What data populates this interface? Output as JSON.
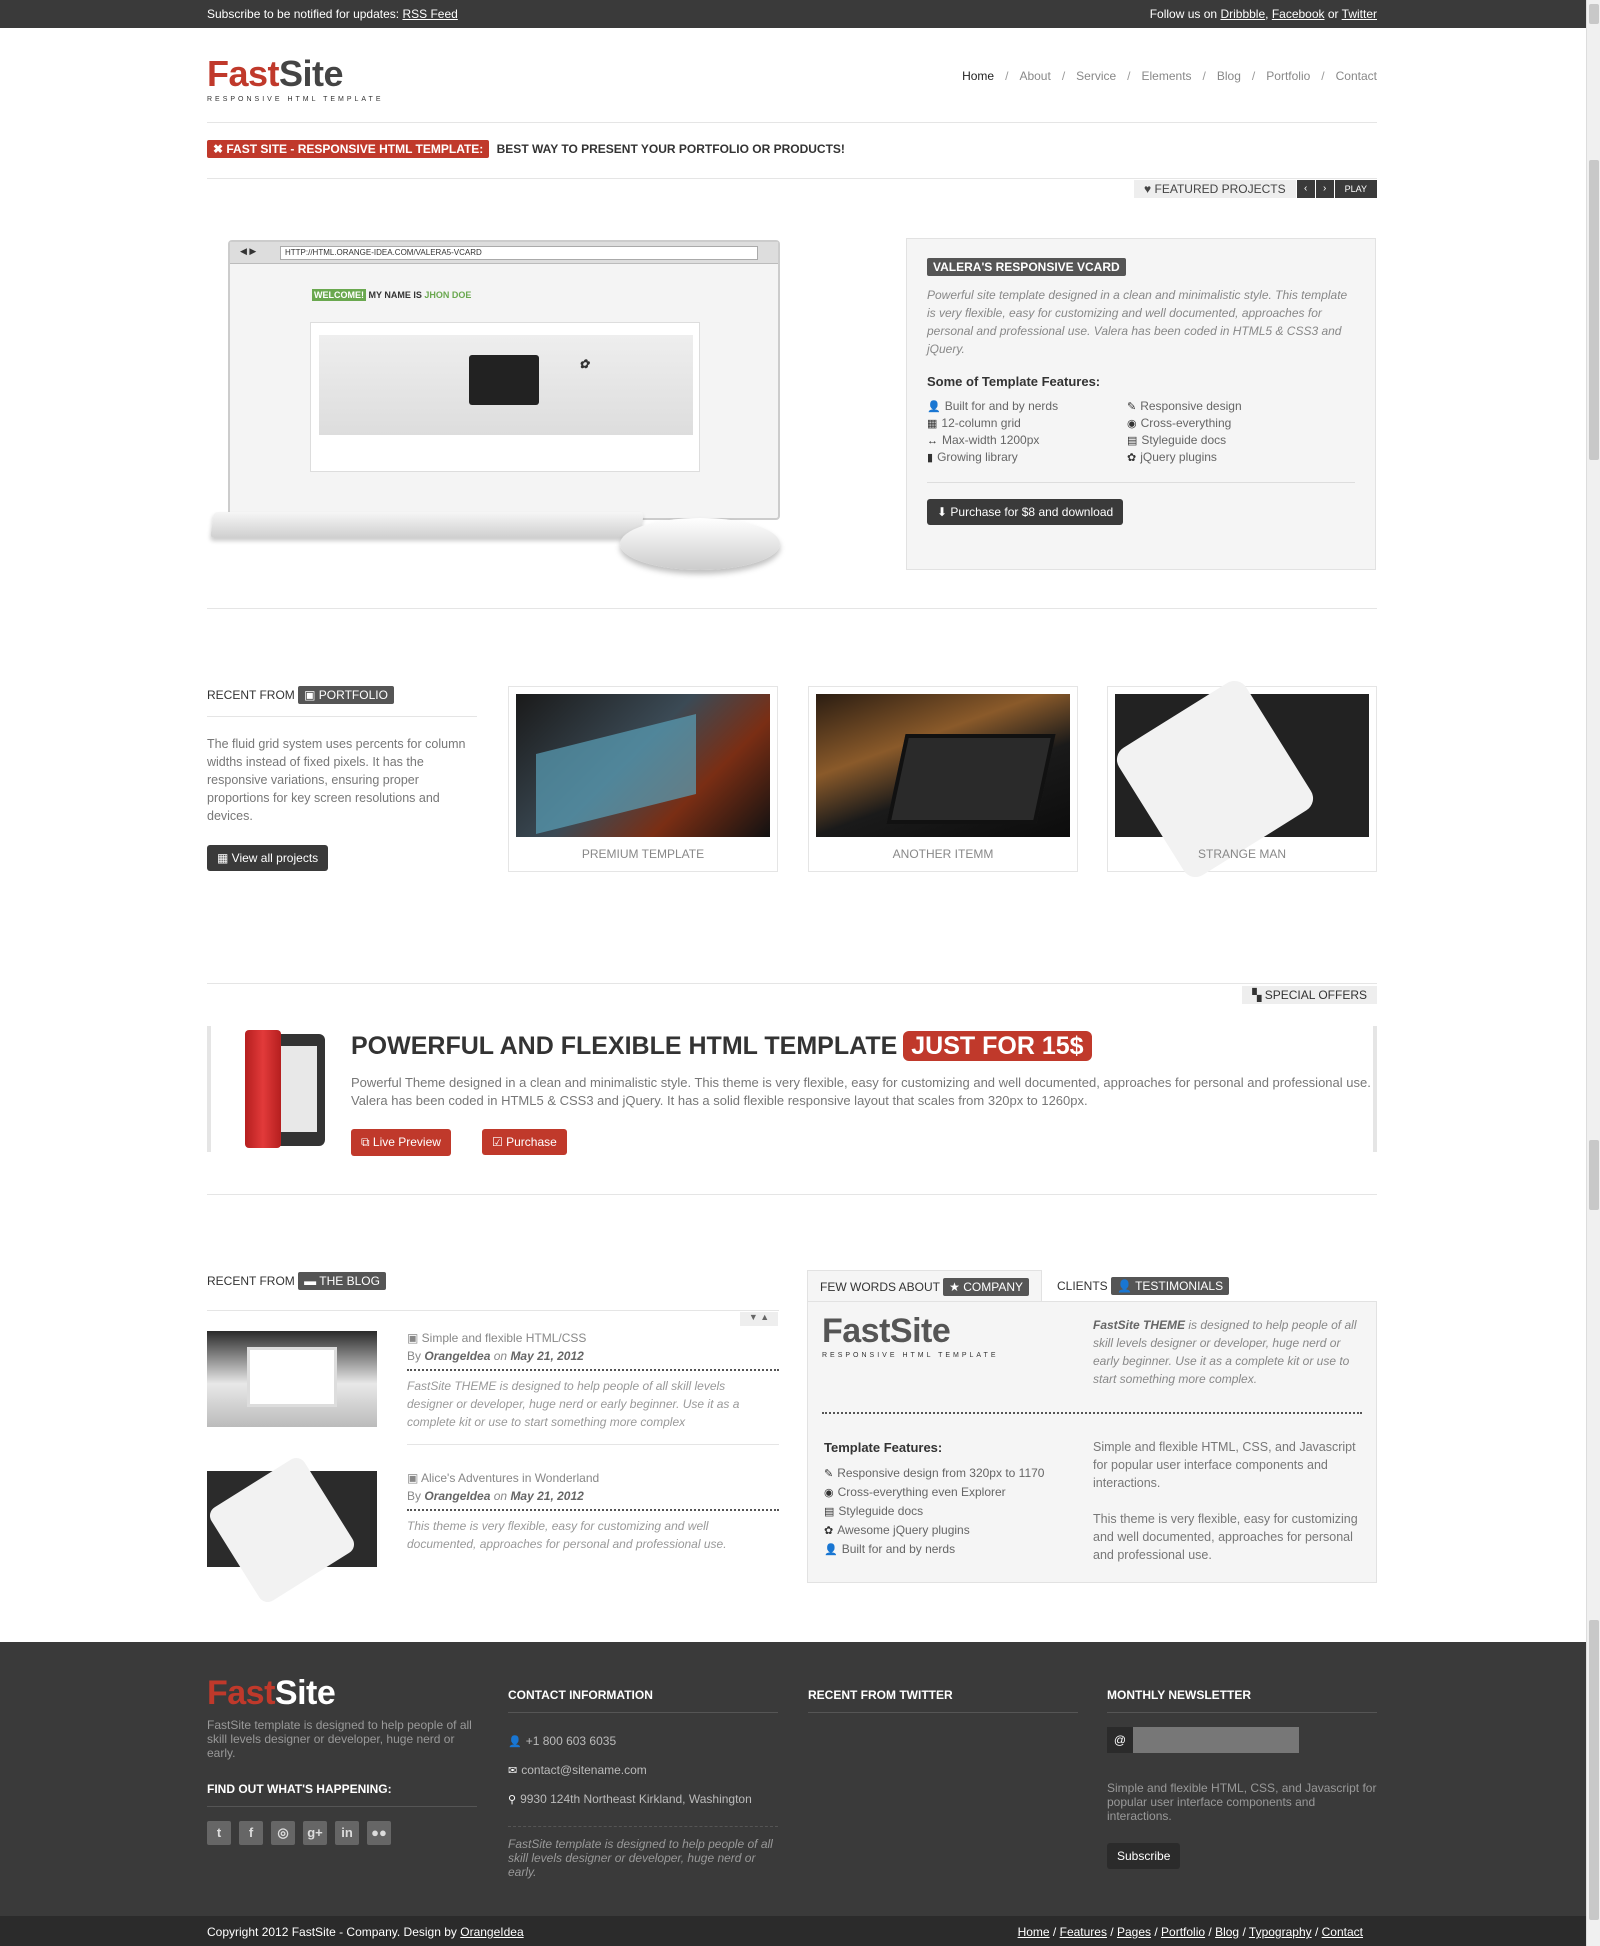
{
  "topbar": {
    "subscribe_text": "Subscribe to be notified for updates:",
    "rss_link": "RSS Feed",
    "follow_text": "Follow us on",
    "dribbble": "Dribbble",
    "facebook": "Facebook",
    "or": "or",
    "twitter": "Twitter"
  },
  "logo": {
    "fast": "Fast",
    "site": "Site",
    "sub": "Responsive HTML Template"
  },
  "nav": {
    "items": [
      "Home",
      "About",
      "Service",
      "Elements",
      "Blog",
      "Portfolio",
      "Contact"
    ],
    "active": "Home",
    "sep": "/"
  },
  "tagline": {
    "tag": "FAST SITE - RESPONSIVE HTML TEMPLATE:",
    "text": "BEST WAY TO PRESENT YOUR PORTFOLIO OR PRODUCTS!"
  },
  "featured": {
    "label": "FEATURED PROJECTS",
    "prev": "‹",
    "next": "›",
    "play": "PLAY"
  },
  "mockup": {
    "url": "HTTP://HTML.ORANGE-IDEA.COM/VALERA5-VCARD",
    "welcome_tag": "WELCOME!",
    "welcome_text": "MY NAME IS",
    "welcome_name": "JHON DOE"
  },
  "vcard": {
    "title": "VALERA'S RESPONSIVE VCARD",
    "description": "Powerful site template designed in a clean and minimalistic style. This template is very flexible, easy for customizing and well documented, approaches for personal and professional use. Valera has been coded in HTML5 & CSS3 and jQuery.",
    "features_heading": "Some of Template Features:",
    "features": [
      {
        "icon": "user-icon",
        "glyph": "👤",
        "label": "Built for and by nerds"
      },
      {
        "icon": "brush-icon",
        "glyph": "✎",
        "label": "Responsive design"
      },
      {
        "icon": "grid-icon",
        "glyph": "▦",
        "label": "12-column grid"
      },
      {
        "icon": "eye-icon",
        "glyph": "◉",
        "label": "Cross-everything"
      },
      {
        "icon": "arrows-h-icon",
        "glyph": "↔",
        "label": "Max-width 1200px"
      },
      {
        "icon": "list-icon",
        "glyph": "▤",
        "label": "Styleguide docs"
      },
      {
        "icon": "book-icon",
        "glyph": "▮",
        "label": "Growing library"
      },
      {
        "icon": "cog-icon",
        "glyph": "✿",
        "label": "jQuery plugins"
      }
    ],
    "purchase_button": "Purchase for $8 and download"
  },
  "portfolio": {
    "title_prefix": "RECENT FROM",
    "title_tag": "PORTFOLIO",
    "text": "The fluid grid system uses percents for column widths instead of fixed pixels. It has the responsive variations, ensuring proper proportions for key screen resolutions and devices.",
    "view_all": "View all projects",
    "items": [
      {
        "caption": "PREMIUM TEMPLATE"
      },
      {
        "caption": "ANOTHER ITEMM"
      },
      {
        "caption": "STRANGE MAN"
      }
    ]
  },
  "special": {
    "label": "SPECIAL OFFERS",
    "headline": "POWERFUL AND FLEXIBLE HTML TEMPLATE",
    "price": "JUST FOR 15$",
    "text": "Powerful Theme designed in a clean and minimalistic style. This theme is very flexible, easy for customizing and well documented, approaches for personal and professional use. Valera has been coded in HTML5 & CSS3 and jQuery. It has a solid flexible responsive layout that scales from 320px to 1260px.",
    "live_preview": "Live Preview",
    "purchase": "Purchase"
  },
  "blog": {
    "title_prefix": "RECENT FROM",
    "title_tag": "THE BLOG",
    "posts": [
      {
        "title": "Simple and flexible HTML/CSS",
        "by": "By",
        "author": "OrangeIdea",
        "on": "on",
        "date": "May 21, 2012",
        "excerpt": "FastSite THEME is designed to help people of all skill levels designer or developer, huge nerd or early beginner. Use it as a complete kit or use to start something more complex"
      },
      {
        "title": "Alice's Adventures in Wonderland",
        "by": "By",
        "author": "OrangeIdea",
        "on": "on",
        "date": "May 21, 2012",
        "excerpt": "This theme is very flexible, easy for customizing and well documented, approaches for personal and professional use."
      }
    ]
  },
  "tabs": [
    {
      "prefix": "FEW WORDS ABOUT",
      "tag": "COMPANY"
    },
    {
      "prefix": "CLIENTS",
      "tag": "TESTIMONIALS"
    }
  ],
  "company": {
    "logo_fast": "Fast",
    "logo_site": "Site",
    "logo_sub": "Responsive HTML Template",
    "intro_bold": "FastSite THEME",
    "intro": "is designed to help people of all skill levels designer or developer, huge nerd or early beginner. Use it as a complete kit or use to start something more complex.",
    "features_heading": "Template Features:",
    "features": [
      {
        "icon": "brush-icon",
        "glyph": "✎",
        "label": "Responsive design from 320px to 1170"
      },
      {
        "icon": "eye-icon",
        "glyph": "◉",
        "label": "Cross-everything even Explorer"
      },
      {
        "icon": "list-icon",
        "glyph": "▤",
        "label": "Styleguide docs"
      },
      {
        "icon": "cog-icon",
        "glyph": "✿",
        "label": "Awesome jQuery plugins"
      },
      {
        "icon": "user-icon",
        "glyph": "👤",
        "label": "Built for and by nerds"
      }
    ],
    "para1": "Simple and flexible HTML, CSS, and Javascript for popular user interface components and interactions.",
    "para2": "This theme is very flexible, easy for customizing and well documented, approaches for personal and professional use."
  },
  "footer": {
    "logo_fast": "Fast",
    "logo_site": "Site",
    "about": "FastSite template is designed to help people of all skill levels designer or developer, huge nerd or early.",
    "happening": "FIND OUT WHAT'S HAPPENING:",
    "social": [
      {
        "icon": "twitter-icon",
        "glyph": "t"
      },
      {
        "icon": "facebook-icon",
        "glyph": "f"
      },
      {
        "icon": "dribbble-icon",
        "glyph": "◎"
      },
      {
        "icon": "google-plus-icon",
        "glyph": "g+"
      },
      {
        "icon": "linkedin-icon",
        "glyph": "in"
      },
      {
        "icon": "flickr-icon",
        "glyph": "●●"
      }
    ],
    "contact_title": "CONTACT INFORMATION",
    "phone": "+1 800 603 6035",
    "email": "contact@sitename.com",
    "address": "9930 124th Northeast Kirkland, Washington",
    "contact_note": "FastSite template is designed to help people of all skill levels designer or developer, huge nerd or early.",
    "twitter_title": "RECENT FROM TWITTER",
    "newsletter_title": "MONTHLY NEWSLETTER",
    "newsletter_text": "Simple and flexible HTML, CSS, and Javascript for popular user interface components and interactions.",
    "subscribe": "Subscribe",
    "at": "@"
  },
  "bottombar": {
    "copyright": "Copyright 2012 FastSite - Company. Design by",
    "designer": "OrangeIdea",
    "links": [
      "Home",
      "Features",
      "Pages",
      "Portfolio",
      "Blog",
      "Typography",
      "Contact"
    ]
  },
  "colors": {
    "accent": "#c0392b",
    "dark": "#3a3a3a",
    "green": "#6aa84f"
  }
}
